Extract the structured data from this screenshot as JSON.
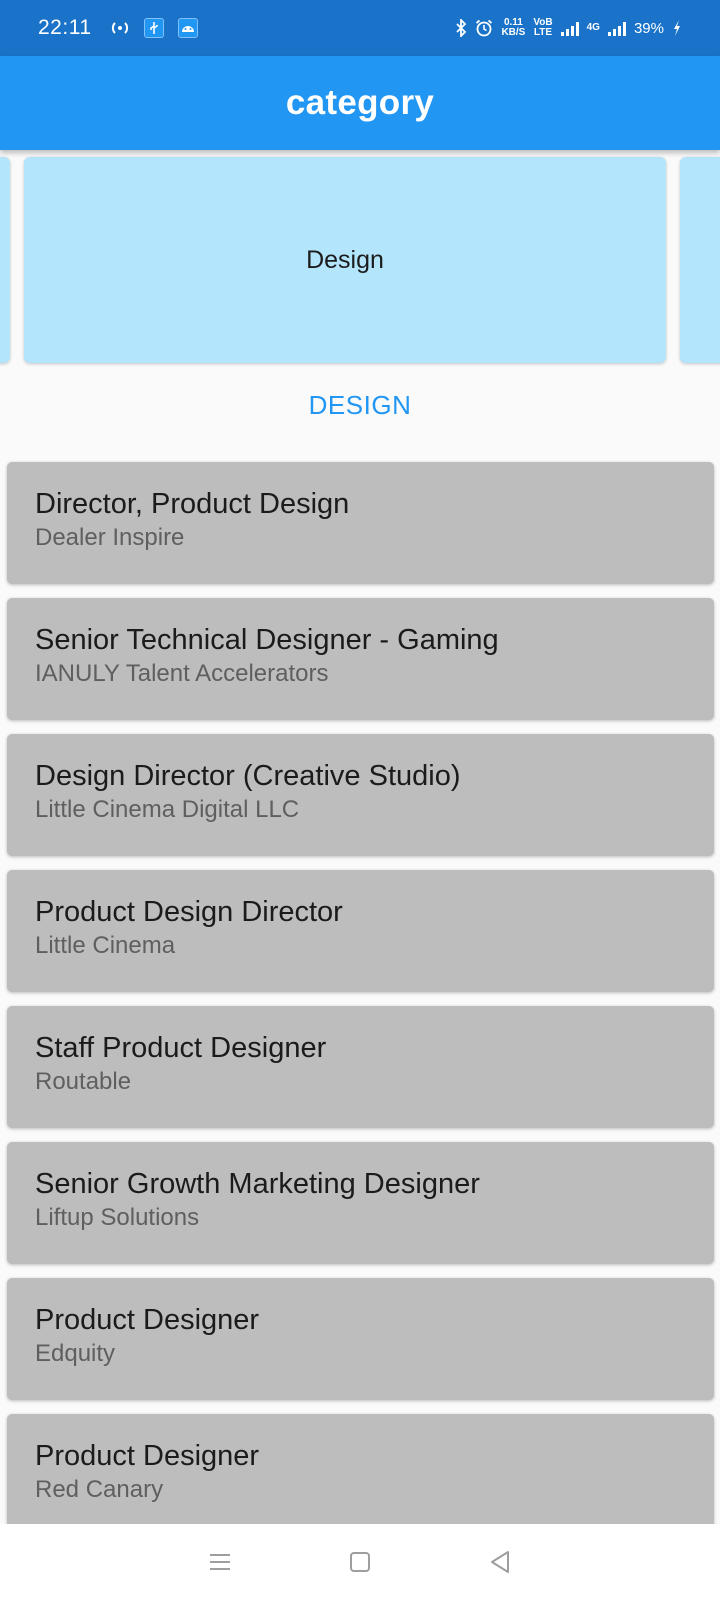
{
  "status_bar": {
    "time": "22:11",
    "data_speed_top": "0.11",
    "data_speed_bottom": "KB/S",
    "volte_top": "VoB",
    "volte_bottom": "LTE",
    "network": "4G",
    "battery": "39%"
  },
  "app_bar": {
    "title": "category"
  },
  "carousel": {
    "current": "Design"
  },
  "section": {
    "heading": "DESIGN"
  },
  "jobs": [
    {
      "title": "Director, Product Design",
      "company": "Dealer Inspire"
    },
    {
      "title": "Senior Technical Designer - Gaming",
      "company": "IANULY Talent Accelerators"
    },
    {
      "title": "Design Director (Creative Studio)",
      "company": "Little Cinema Digital LLC"
    },
    {
      "title": "Product Design Director",
      "company": "Little Cinema"
    },
    {
      "title": "Staff Product Designer",
      "company": "Routable"
    },
    {
      "title": "Senior Growth Marketing Designer",
      "company": "Liftup Solutions"
    },
    {
      "title": "Product Designer",
      "company": "Edquity"
    },
    {
      "title": "Product Designer",
      "company": "Red Canary"
    }
  ],
  "colors": {
    "status_bar": "#1a73c8",
    "app_bar": "#2196f3",
    "category_card": "#b3e5fc",
    "job_card": "#bdbdbd",
    "accent": "#2196f3"
  },
  "icons": {
    "status_left": [
      "hotspot-icon",
      "usb-icon",
      "android-icon"
    ],
    "status_right": [
      "bluetooth-icon",
      "alarm-icon",
      "signal-icon",
      "charging-icon"
    ],
    "nav": [
      "menu-icon",
      "home-icon",
      "back-icon"
    ]
  }
}
